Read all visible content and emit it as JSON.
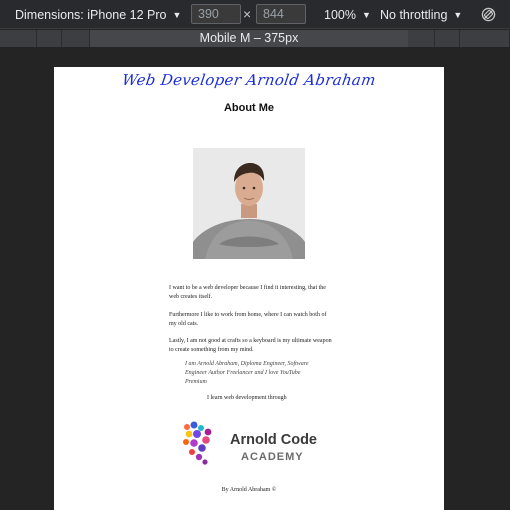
{
  "toolbar": {
    "dimensions_label": "Dimensions: iPhone 12 Pro",
    "width_value": "390",
    "height_value": "844",
    "times_symbol": "×",
    "zoom": "100%",
    "throttling": "No throttling"
  },
  "media_query_bar": {
    "label": "Mobile M – 375px"
  },
  "page": {
    "site_title": "Web Developer Arnold Abraham",
    "heading": "About Me",
    "paragraphs": [
      "I want to be a web developer because I find it interesting, that the web creates itself.",
      "Furthermore I like to work from home, where I can watch both of my old cats.",
      "Lastly, I am not good at crafts so a keyboard is my ultimate weapon to create something from my mind."
    ],
    "quote": "I am Arnold Abraham, Diploma Engineer, Software Engineer Author Freelancer and I love YouTube Premium",
    "learning_line": "I learn web development through",
    "logo": {
      "line1": "Arnold Code",
      "line2": "ACADEMY"
    },
    "footer": "By Arnold Abraham ©"
  }
}
